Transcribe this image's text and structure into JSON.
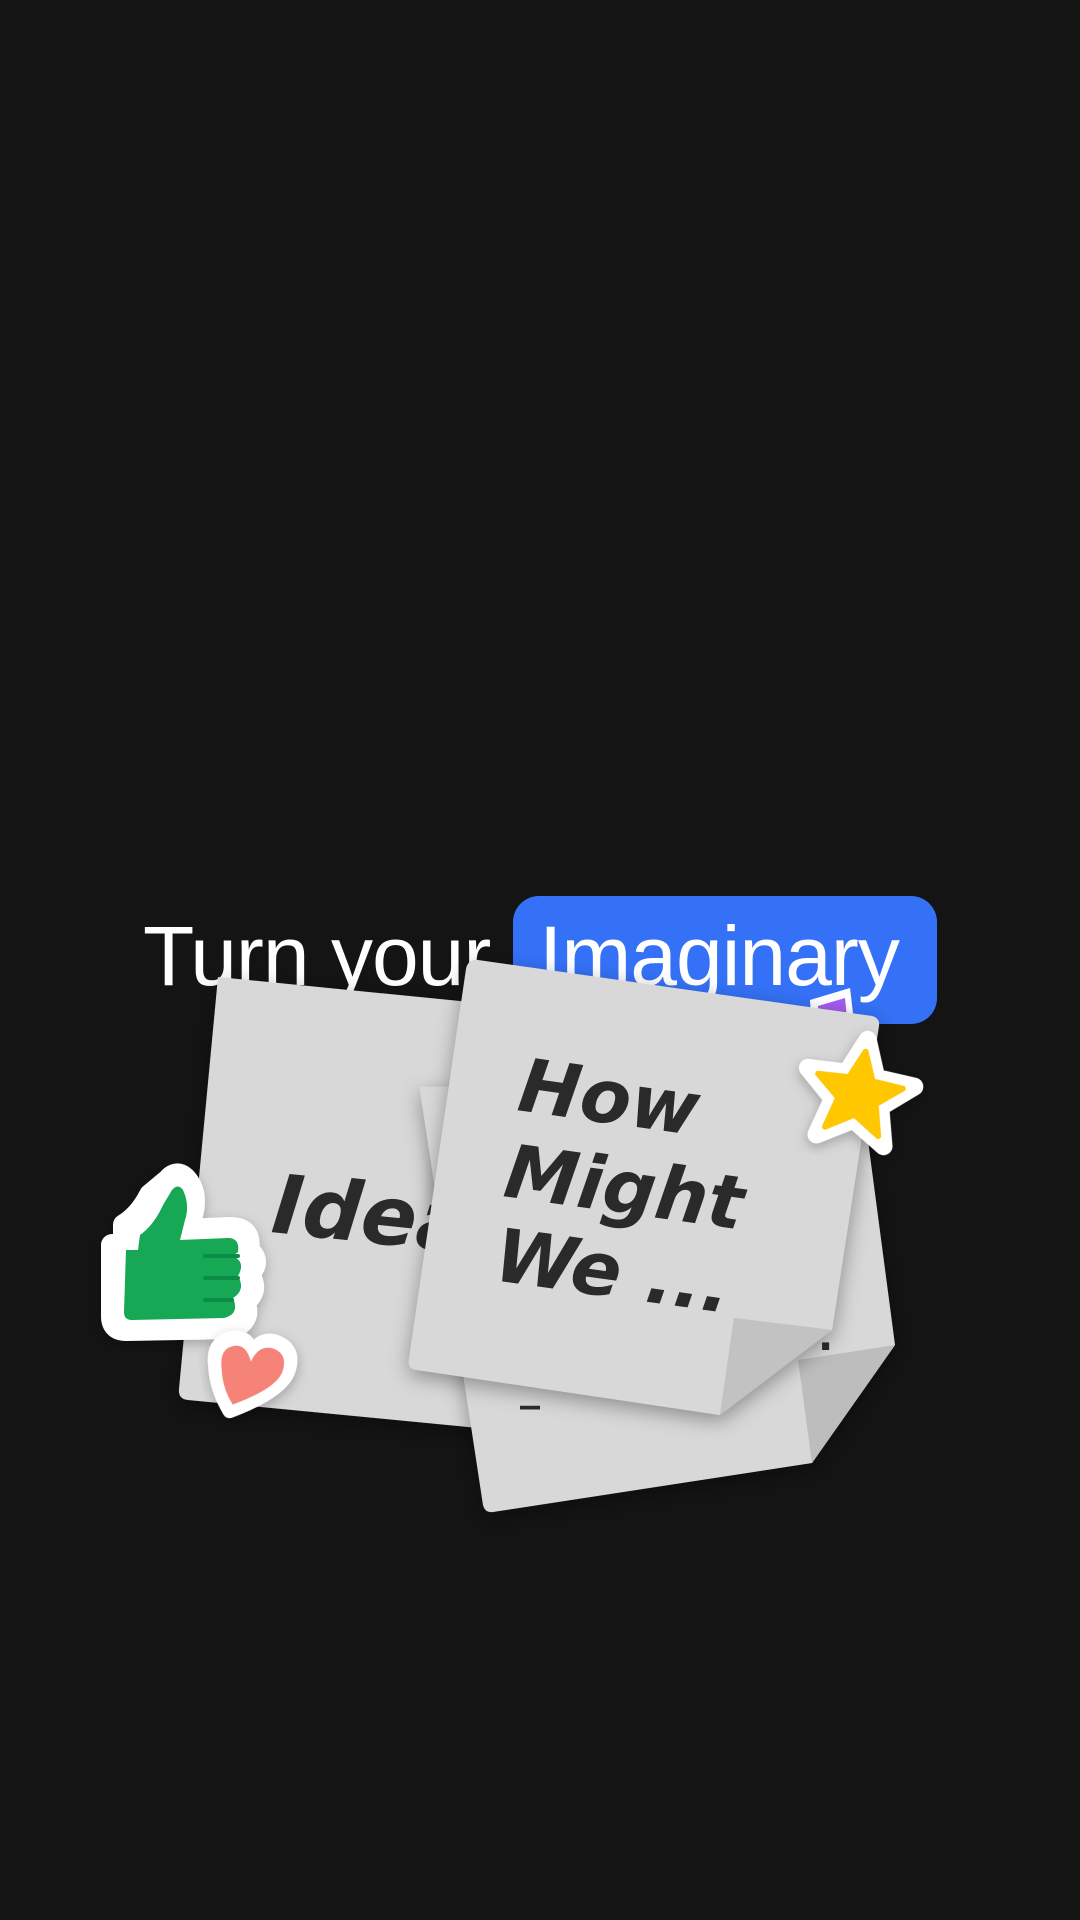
{
  "headline": {
    "prefix": "Turn your",
    "highlight": "Imaginary"
  },
  "notes": {
    "left": "Idea",
    "front_line1": "How",
    "front_line2": "Might",
    "front_line3": "We ..."
  },
  "stickers": {
    "thumbs_up": "thumbs-up-icon",
    "heart": "heart-icon",
    "star": "star-icon",
    "purple": "purple-tab-icon"
  },
  "colors": {
    "background": "#141414",
    "accent": "#3571f7",
    "note": "#d8d8d8",
    "note_shadow": "#bdbdbd",
    "thumbs": "#12a854",
    "heart": "#f58377",
    "star": "#ffc700",
    "purple": "#a45cf0"
  }
}
